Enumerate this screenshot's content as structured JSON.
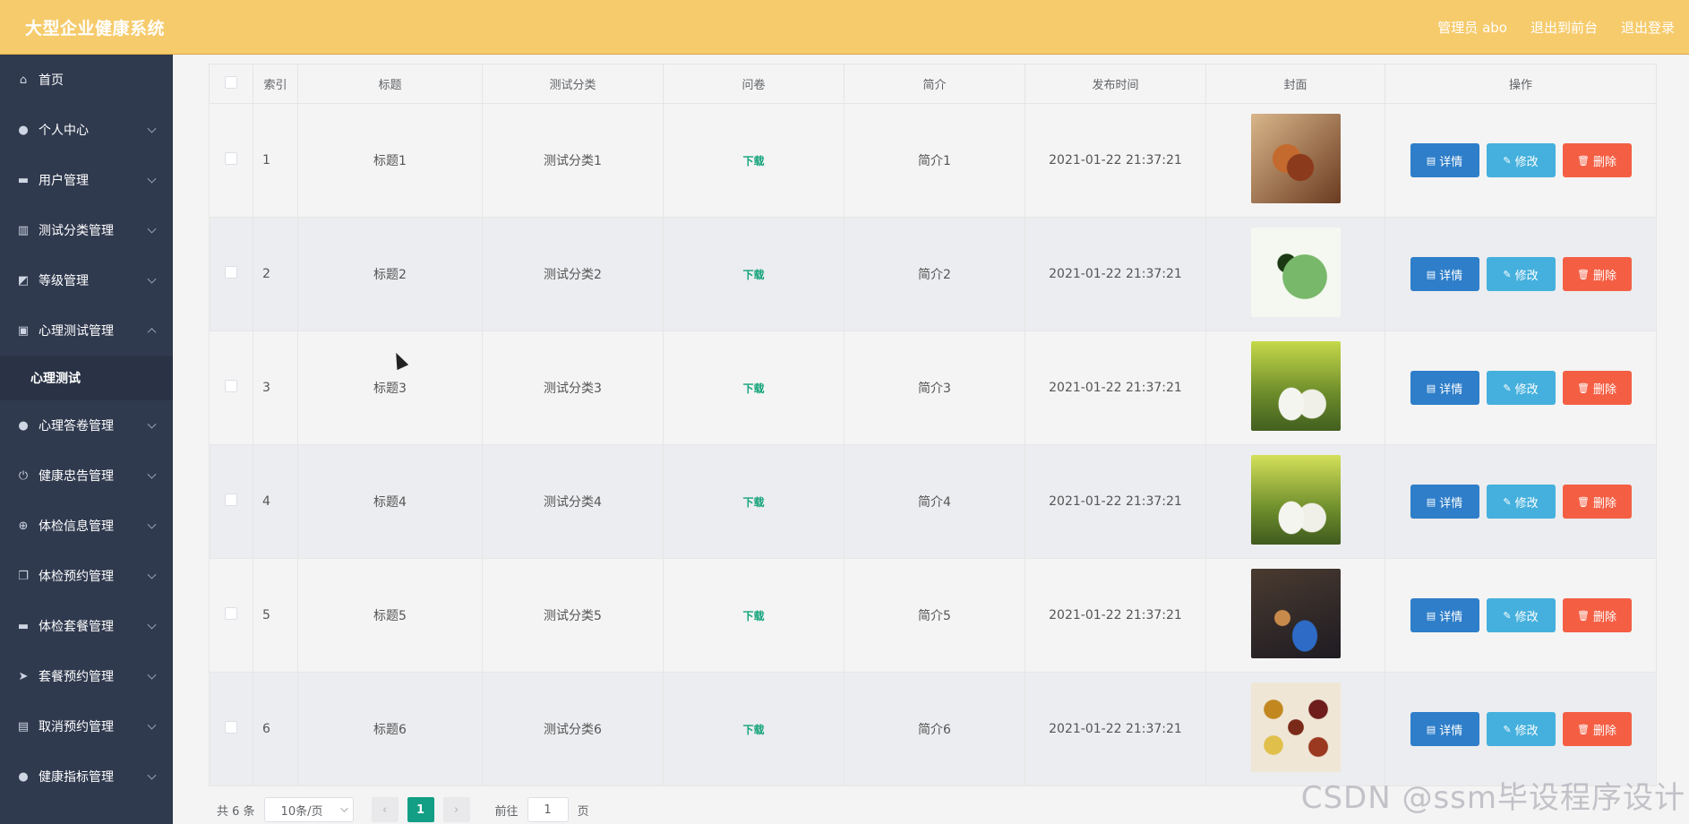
{
  "header": {
    "title": "大型企业健康系统",
    "links": [
      "管理员 abo",
      "退出到前台",
      "退出登录"
    ]
  },
  "sidebar": {
    "items": [
      {
        "label": "首页",
        "icon": "home-icon",
        "chevron": "none"
      },
      {
        "label": "个人中心",
        "icon": "user-icon",
        "chevron": "down"
      },
      {
        "label": "用户管理",
        "icon": "users-icon",
        "chevron": "down"
      },
      {
        "label": "测试分类管理",
        "icon": "category-icon",
        "chevron": "down"
      },
      {
        "label": "等级管理",
        "icon": "chart-icon",
        "chevron": "down"
      },
      {
        "label": "心理测试管理",
        "icon": "clipboard-icon",
        "chevron": "up"
      },
      {
        "label": "心理测试",
        "icon": "",
        "chevron": "sub"
      },
      {
        "label": "心理答卷管理",
        "icon": "user-icon",
        "chevron": "down"
      },
      {
        "label": "健康忠告管理",
        "icon": "power-icon",
        "chevron": "down"
      },
      {
        "label": "体检信息管理",
        "icon": "target-icon",
        "chevron": "down"
      },
      {
        "label": "体检预约管理",
        "icon": "copy-icon",
        "chevron": "down"
      },
      {
        "label": "体检套餐管理",
        "icon": "package-icon",
        "chevron": "down"
      },
      {
        "label": "套餐预约管理",
        "icon": "send-icon",
        "chevron": "down"
      },
      {
        "label": "取消预约管理",
        "icon": "cancel-icon",
        "chevron": "down"
      },
      {
        "label": "健康指标管理",
        "icon": "user-icon",
        "chevron": "down"
      }
    ]
  },
  "table": {
    "columns": [
      "",
      "索引",
      "标题",
      "测试分类",
      "问卷",
      "简介",
      "发布时间",
      "封面",
      "操作"
    ],
    "rows": [
      {
        "index": "1",
        "title": "标题1",
        "category": "测试分类1",
        "survey": "下载",
        "intro": "简介1",
        "time": "2021-01-22 21:37:21"
      },
      {
        "index": "2",
        "title": "标题2",
        "category": "测试分类2",
        "survey": "下载",
        "intro": "简介2",
        "time": "2021-01-22 21:37:21"
      },
      {
        "index": "3",
        "title": "标题3",
        "category": "测试分类3",
        "survey": "下载",
        "intro": "简介3",
        "time": "2021-01-22 21:37:21"
      },
      {
        "index": "4",
        "title": "标题4",
        "category": "测试分类4",
        "survey": "下载",
        "intro": "简介4",
        "time": "2021-01-22 21:37:21"
      },
      {
        "index": "5",
        "title": "标题5",
        "category": "测试分类5",
        "survey": "下载",
        "intro": "简介5",
        "time": "2021-01-22 21:37:21"
      },
      {
        "index": "6",
        "title": "标题6",
        "category": "测试分类6",
        "survey": "下载",
        "intro": "简介6",
        "time": "2021-01-22 21:37:21"
      }
    ],
    "actions": {
      "detail": "详情",
      "edit": "修改",
      "delete": "删除"
    }
  },
  "pager": {
    "total": "共 6 条",
    "page_size": "10条/页",
    "current": "1",
    "goto_prefix": "前往",
    "goto_value": "1",
    "goto_suffix": "页"
  },
  "watermark": "CSDN @ssm毕设程序设计",
  "colors": {
    "header": "#f6cb6c",
    "sidebar": "#303a4f",
    "primary": "#139f85",
    "detail": "#2e7ec9",
    "edit": "#45b0dd",
    "delete": "#f45f44"
  }
}
